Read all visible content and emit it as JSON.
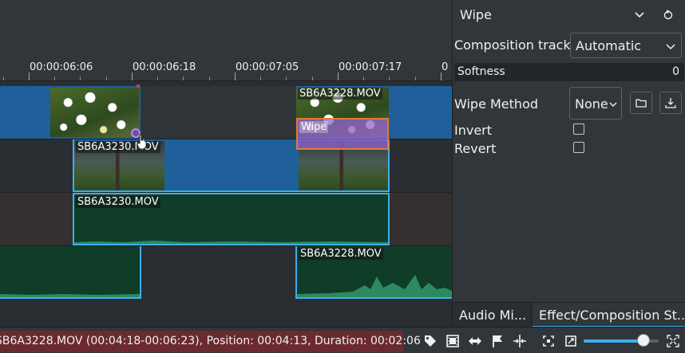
{
  "ruler": {
    "ticks": [
      "00:00:06:06",
      "00:00:06:18",
      "00:00:07:05",
      "00:00:07:17",
      "0"
    ]
  },
  "clips": {
    "v2_right_label": "SB6A3228.MOV",
    "v1_label": "SB6A3230.MOV",
    "a1_label": "SB6A3230.MOV",
    "a2_label": "SB6A3228.MOV"
  },
  "composition": {
    "label": "Wipe"
  },
  "panel": {
    "title": "Wipe",
    "composition_track_label": "Composition track:",
    "composition_track_value": "Automatic",
    "softness_label": "Softness",
    "softness_value": "0",
    "wipe_method_label": "Wipe Method",
    "wipe_method_value": "None",
    "invert_label": "Invert",
    "invert_checked": false,
    "revert_label": "Revert",
    "revert_checked": false
  },
  "tabs": {
    "audio": "Audio Mi...",
    "effect": "Effect/Composition St..."
  },
  "status": {
    "message": "SB6A3228.MOV (00:04:18-00:06:23), Position: 00:04:13, Duration: 00:02:06"
  },
  "toolbar_icons": [
    "tag-icon",
    "film-icon",
    "sync-icon",
    "flag-icon",
    "split-icon",
    "fit-zoom-icon",
    "zoom-reset-icon",
    "fullscreen-icon"
  ],
  "zoom": {
    "level_fraction": 0.8
  },
  "colors": {
    "accent": "#3daee9",
    "video_clip": "#1f5f9a",
    "audio_clip": "#0f3d28",
    "composition": "#9664d2",
    "composition_border": "#e07b39",
    "status_error_bg": "#6b2a2f"
  }
}
